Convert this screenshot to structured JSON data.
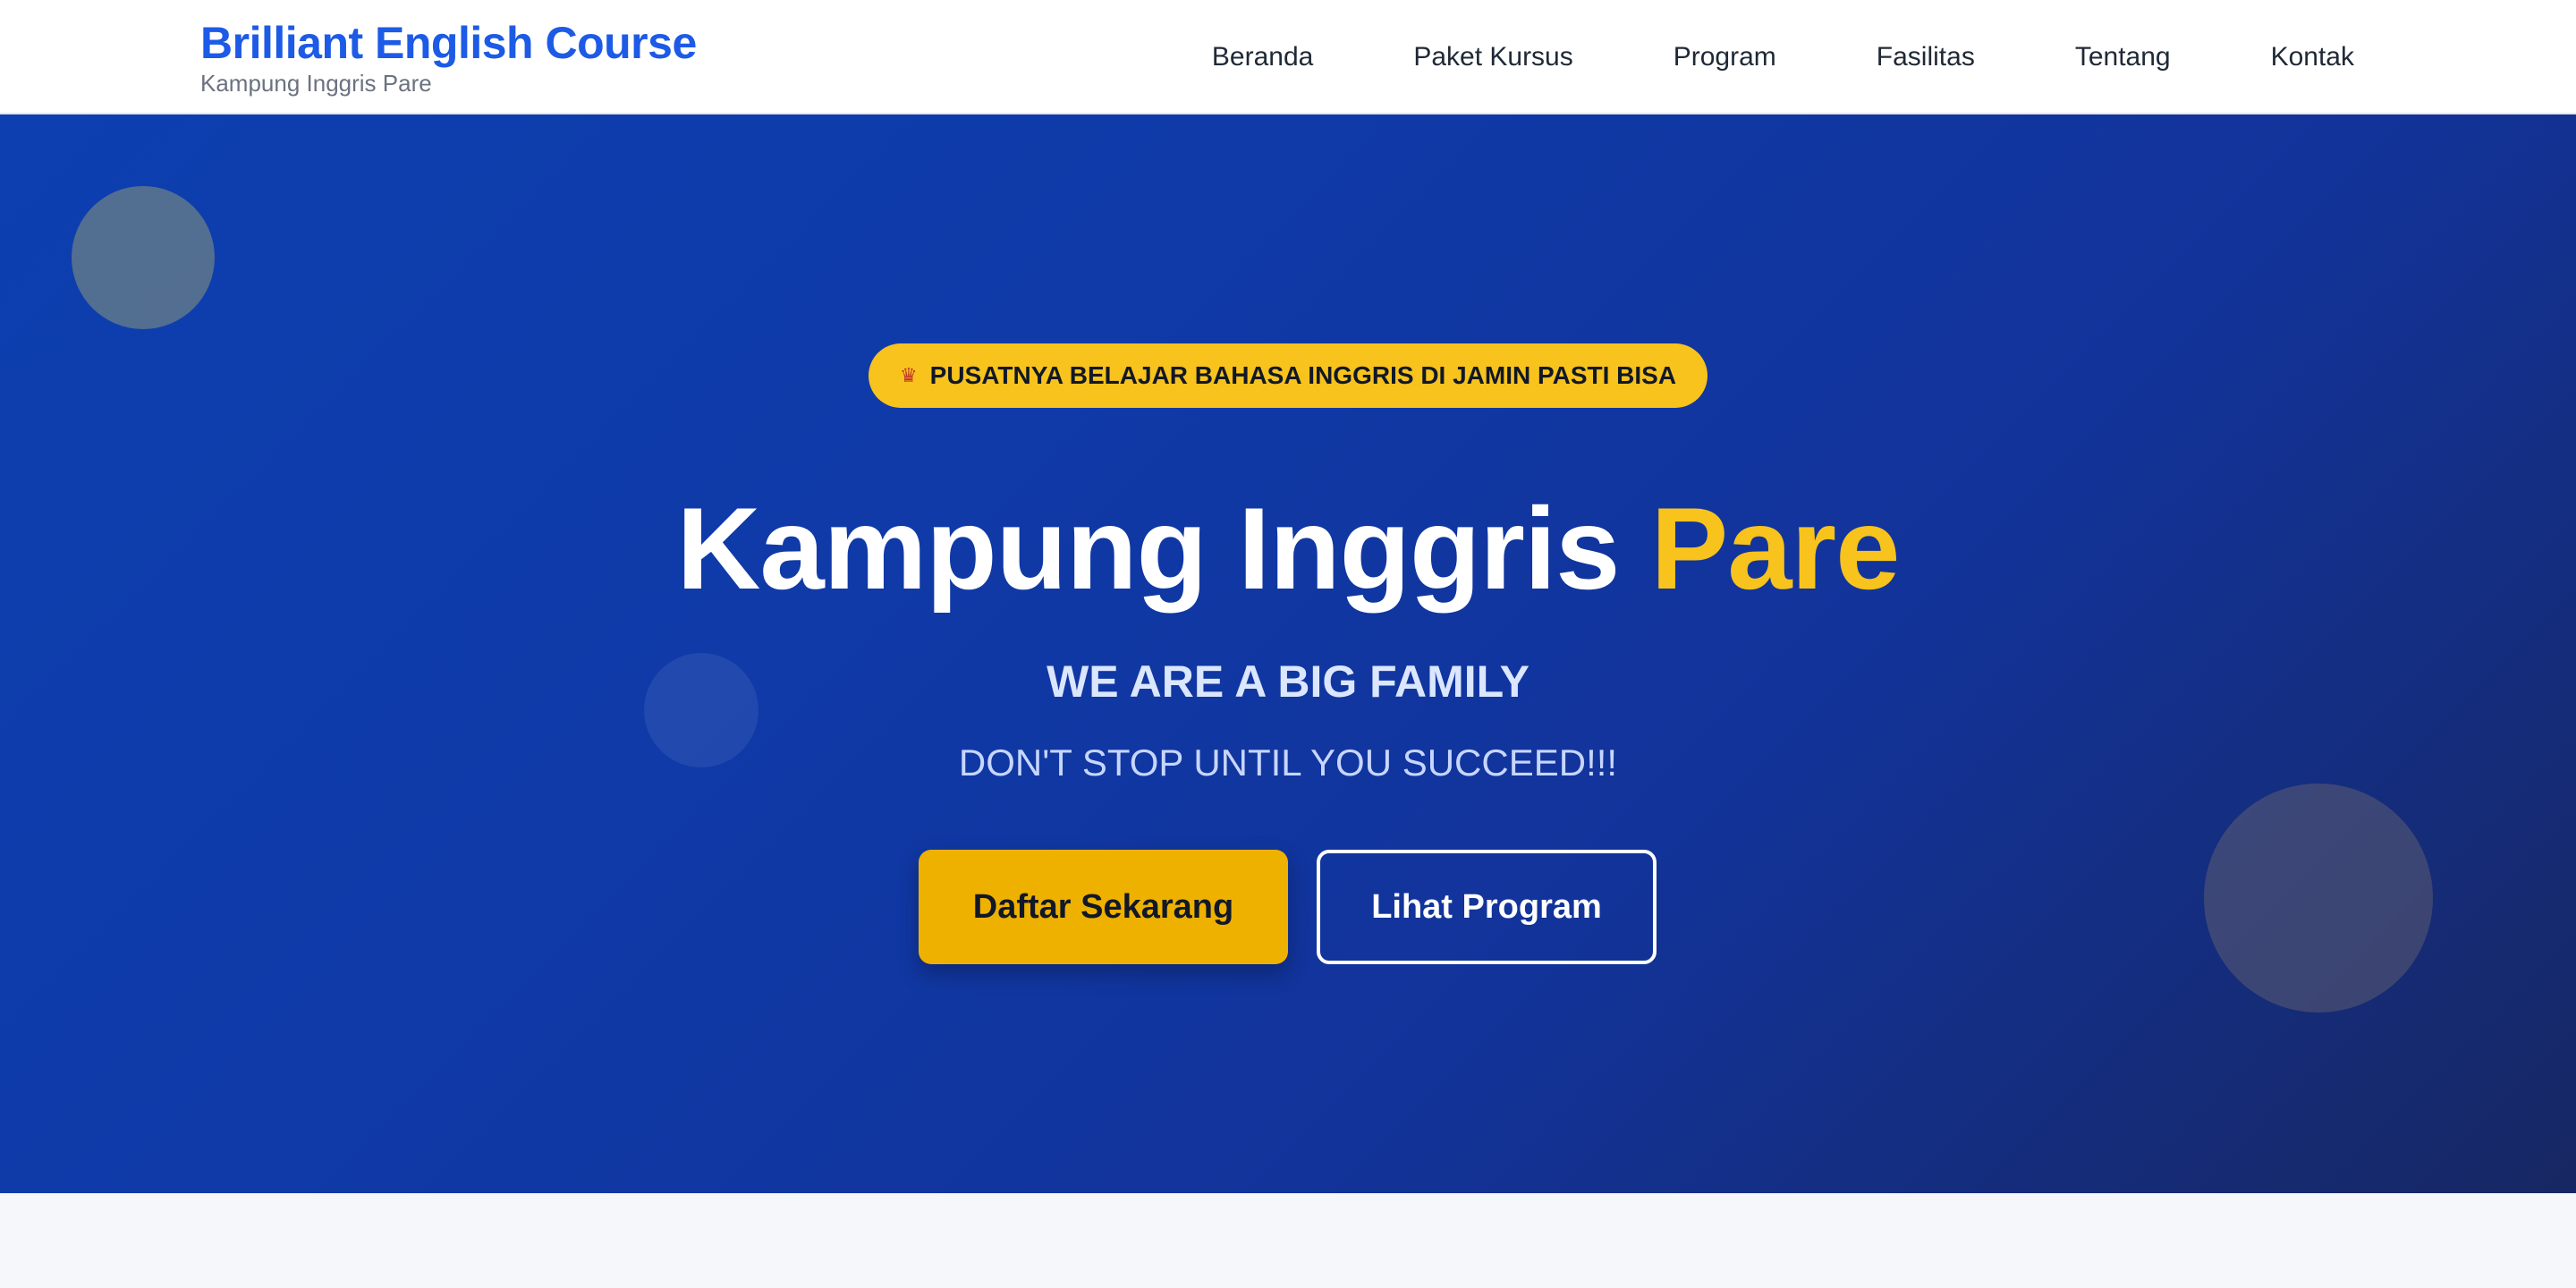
{
  "colors": {
    "brand": "#1d5ae6",
    "accent_yellow": "#f7c31c",
    "button_yellow": "#eeb100",
    "hero_blue": "#0f3aa8",
    "hero_blue_dark": "#172763"
  },
  "header": {
    "brand_title": "Brilliant English Course",
    "brand_subtitle": "Kampung Inggris Pare",
    "nav": [
      {
        "label": "Beranda"
      },
      {
        "label": "Paket Kursus"
      },
      {
        "label": "Program"
      },
      {
        "label": "Fasilitas"
      },
      {
        "label": "Tentang"
      },
      {
        "label": "Kontak"
      }
    ]
  },
  "hero": {
    "badge": {
      "icon": "crown-icon",
      "text": "PUSATNYA BELAJAR BAHASA INGGRIS DI JAMIN PASTI BISA"
    },
    "title_main": "Kampung Inggris",
    "title_accent": "Pare",
    "tagline": "WE ARE A BIG FAMILY",
    "motto": "DON'T STOP UNTIL YOU SUCCEED!!!",
    "primary_button": "Daftar Sekarang",
    "secondary_button": "Lihat Program"
  }
}
